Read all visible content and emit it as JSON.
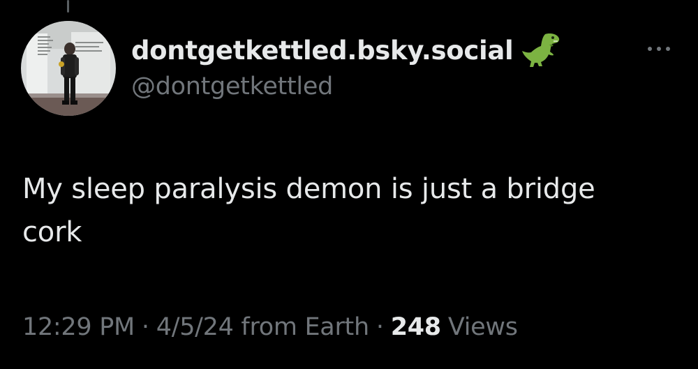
{
  "post": {
    "author": {
      "display_name": "dontgetkettled.bsky.social",
      "badge_icon": "t-rex-emoji",
      "handle": "@dontgetkettled",
      "avatar_icon": "profile-photo"
    },
    "more_icon": "ellipsis-icon",
    "text": "My sleep paralysis demon is just a bridge\ncork",
    "meta": {
      "time": "12:29 PM",
      "separator": "·",
      "date": "4/5/24",
      "source": "from Earth",
      "views_count": "248",
      "views_label": "Views"
    }
  },
  "colors": {
    "background": "#000000",
    "primary_text": "#e7e9ea",
    "secondary_text": "#71767b",
    "dino_green": "#7cb342"
  }
}
